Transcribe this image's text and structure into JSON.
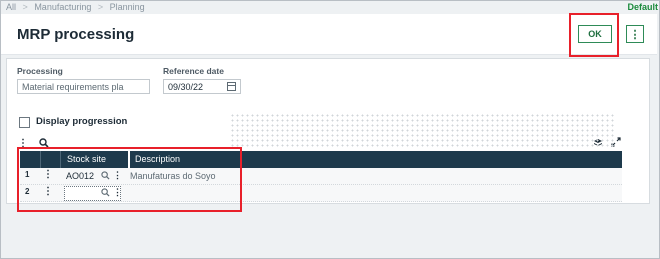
{
  "breadcrumb": {
    "items": [
      "All",
      "Manufacturing",
      "Planning"
    ],
    "separator": ">"
  },
  "default_label": "Default",
  "page": {
    "title": "MRP processing"
  },
  "actions": {
    "ok_label": "OK",
    "more_label": "⋮"
  },
  "form": {
    "processing": {
      "label": "Processing",
      "value": "Material requirements pla"
    },
    "reference_date": {
      "label": "Reference date",
      "value": "09/30/22"
    },
    "display_progression": {
      "label": "Display progression",
      "checked": false
    }
  },
  "grid": {
    "columns": [
      "Stock site",
      "Description"
    ],
    "rows": [
      {
        "num": "1",
        "stock_site": "AO012",
        "description": "Manufaturas do Soyo"
      },
      {
        "num": "2",
        "stock_site": "",
        "description": ""
      }
    ]
  },
  "icons": {
    "menu": "kebab-icon",
    "search": "search-icon",
    "layers": "layers-icon",
    "expand": "expand-icon",
    "calendar": "calendar-icon"
  },
  "colors": {
    "accent": "#2e8b57",
    "grid_header": "#1e3a4c",
    "highlight": "#e8202a"
  }
}
